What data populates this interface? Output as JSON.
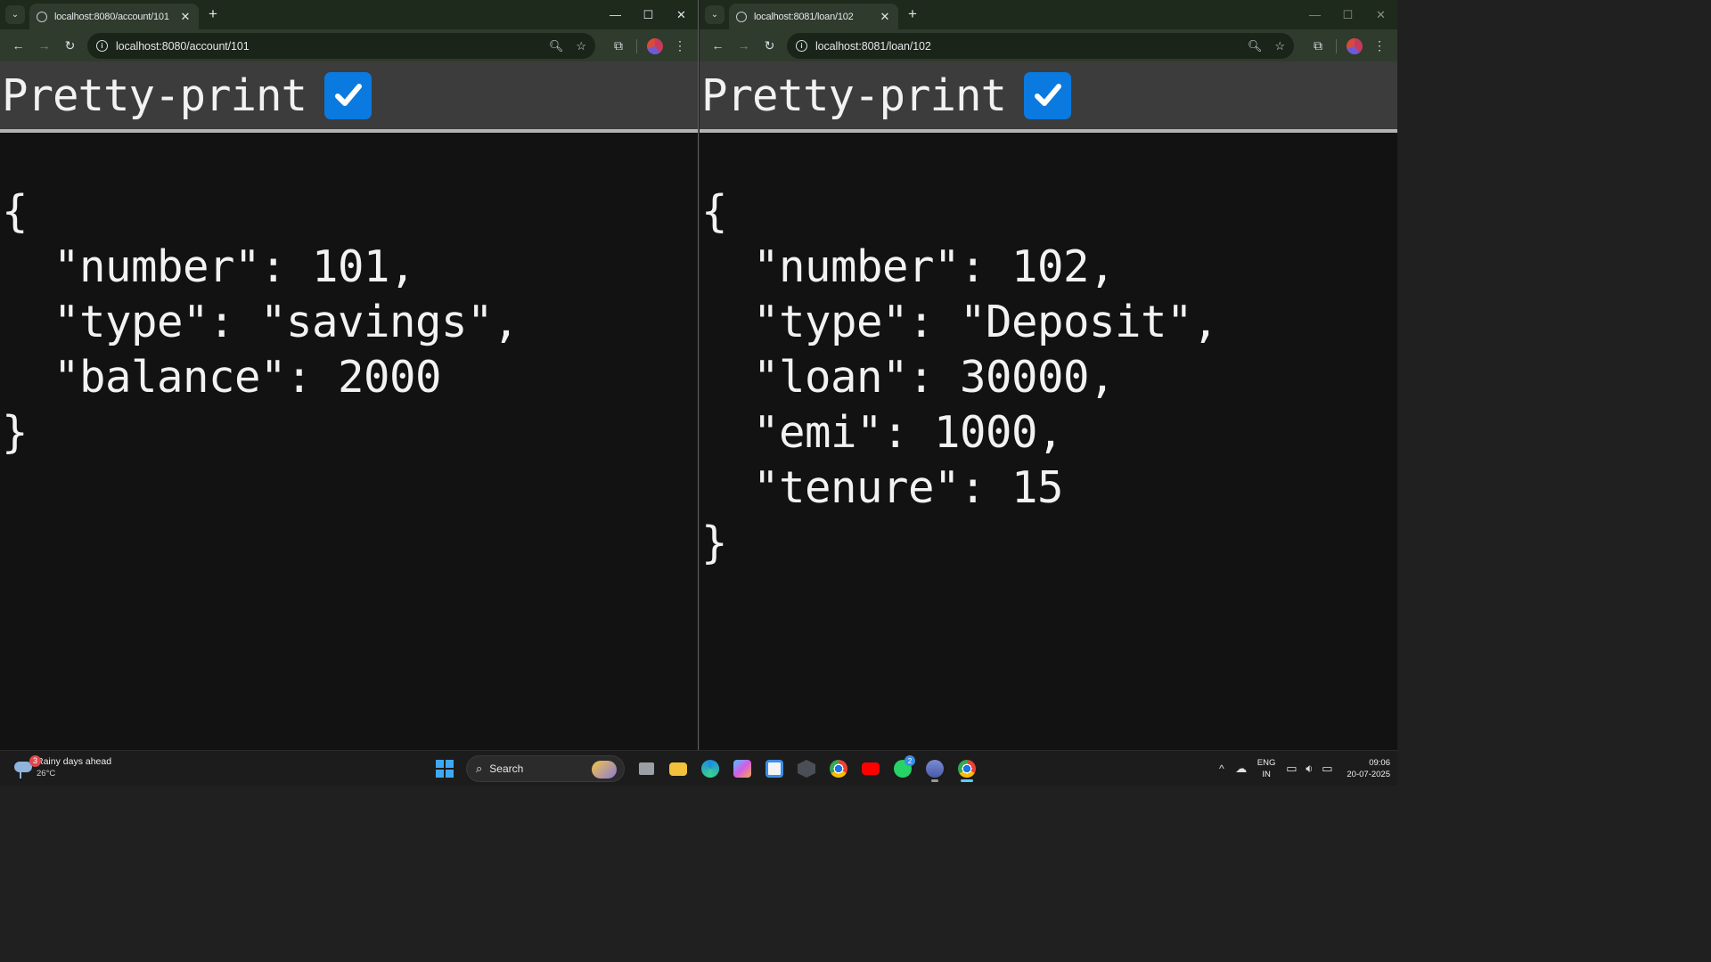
{
  "windows": {
    "left": {
      "tab_title": "localhost:8080/account/101",
      "url": "localhost:8080/account/101",
      "pretty_print_label": "Pretty-print",
      "pretty_print_checked": true,
      "json_lines": [
        "{",
        "  \"number\": 101,",
        "  \"type\": \"savings\",",
        "  \"balance\": 2000",
        "}"
      ]
    },
    "right": {
      "tab_title": "localhost:8081/loan/102",
      "url": "localhost:8081/loan/102",
      "pretty_print_label": "Pretty-print",
      "pretty_print_checked": true,
      "json_lines": [
        "{",
        "  \"number\": 102,",
        "  \"type\": \"Deposit\",",
        "  \"loan\": 30000,",
        "  \"emi\": 1000,",
        "  \"tenure\": 15",
        "}"
      ]
    }
  },
  "taskbar": {
    "weather_title": "Rainy days ahead",
    "weather_temp": "26°C",
    "weather_badge": "3",
    "search_label": "Search",
    "whatsapp_badge": "2",
    "lang_top": "ENG",
    "lang_bottom": "IN",
    "time": "09:06",
    "date": "20-07-2025"
  },
  "colors": {
    "accent": "#0a7ae0",
    "page_bg": "#121212",
    "chrome_frame": "#2f3b2c"
  }
}
